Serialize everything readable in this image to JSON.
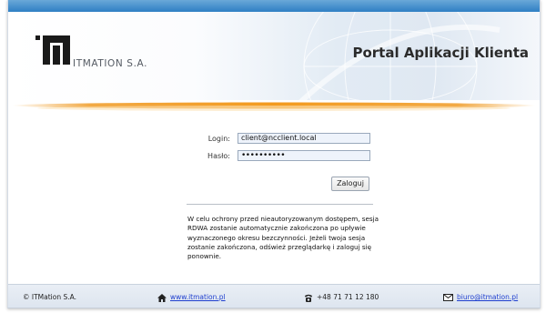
{
  "header": {
    "company_name": "ITMATION S.A.",
    "portal_title": "Portal Aplikacji Klienta"
  },
  "login_form": {
    "login_label": "Login:",
    "login_value": "client@ncclient.local",
    "password_label": "Hasło:",
    "password_value": "••••••••••",
    "submit_label": "Zaloguj"
  },
  "notice": "W celu ochrony przed nieautoryzowanym dostępem, sesja RDWA zostanie automatycznie zakończona po upływie wyznaczonego okresu bezczynności. Jeżeli twoja sesja zostanie zakończona, odśwież przeglądarkę i zaloguj się ponownie.",
  "footer": {
    "copyright": "© ITMation S.A.",
    "website": "www.itmation.pl",
    "phone": "+48 71 71 12 180",
    "email": "biuro@itmation.pl",
    "icons": [
      "home-icon",
      "phone-icon",
      "envelope-icon"
    ]
  },
  "colors": {
    "top_bar": "#2f7fc4",
    "accent_orange": "#f0a030",
    "link": "#1f3fcf"
  }
}
